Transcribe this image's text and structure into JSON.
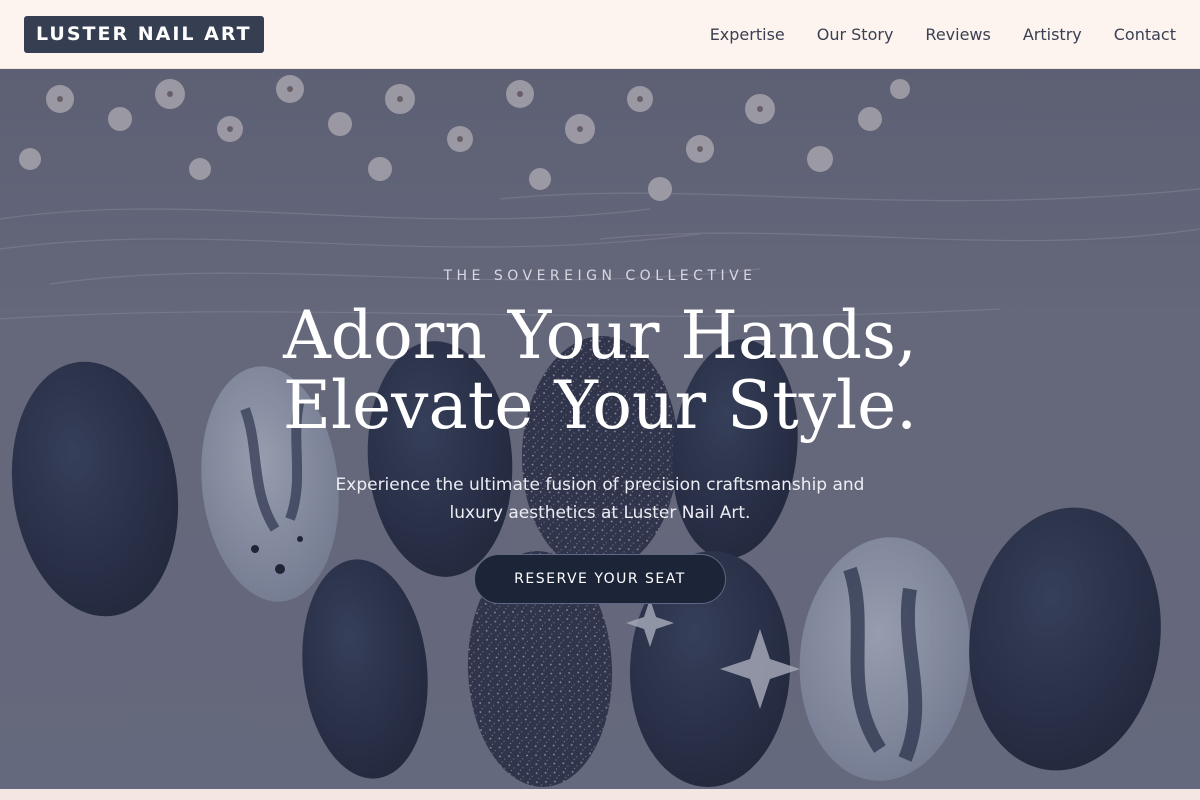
{
  "header": {
    "logo": "LUSTER NAIL ART",
    "nav": [
      "Expertise",
      "Our Story",
      "Reviews",
      "Artistry",
      "Contact"
    ]
  },
  "hero": {
    "eyebrow": "THE SOVEREIGN COLLECTIVE",
    "headline_line1": "Adorn Your Hands,",
    "headline_line2": "Elevate Your Style.",
    "subtext": "Experience the ultimate fusion of precision craftsmanship and luxury aesthetics at Luster Nail Art.",
    "cta": "RESERVE YOUR SEAT",
    "background": "photo of dark navy press-on nails with white marble and glitter designs beside dried white flowers"
  },
  "colors": {
    "header_bg": "#fdf4f0",
    "logo_bg": "#363e52",
    "nav_text": "#3a4052",
    "cta_bg": "#1c2438"
  }
}
